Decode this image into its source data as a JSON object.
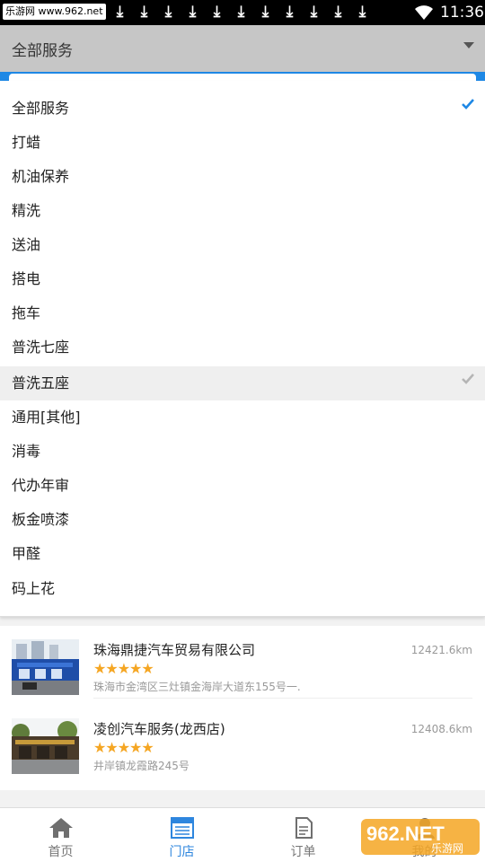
{
  "status_bar": {
    "watermark": "乐游网 www.962.net",
    "download_icons": [
      "download-icon",
      "download-icon",
      "download-icon",
      "download-icon",
      "download-icon",
      "download-icon",
      "download-icon",
      "download-icon",
      "download-icon",
      "download-icon",
      "download-icon"
    ],
    "time": "11:36"
  },
  "header": {
    "selected": "全部服务"
  },
  "dropdown": {
    "options": [
      {
        "label": "全部服务",
        "checked": true
      },
      {
        "label": "打蜡"
      },
      {
        "label": "机油保养"
      },
      {
        "label": "精洗"
      },
      {
        "label": "送油"
      },
      {
        "label": "搭电"
      },
      {
        "label": "拖车"
      },
      {
        "label": "普洗七座"
      },
      {
        "label": "普洗五座",
        "highlighted": true
      },
      {
        "label": "通用[其他]"
      },
      {
        "label": "消毒"
      },
      {
        "label": "代办年审"
      },
      {
        "label": "板金喷漆"
      },
      {
        "label": "甲醛"
      },
      {
        "label": "码上花"
      }
    ],
    "check_color": "#1e88e5"
  },
  "stores": [
    {
      "name": "珠海鼎捷汽车贸易有限公司",
      "distance": "12421.6km",
      "rating": 5,
      "stars": "★★★★★",
      "address": "珠海市金湾区三灶镇金海岸大道东155号一."
    },
    {
      "name": "凌创汽车服务(龙西店)",
      "distance": "12408.6km",
      "rating": 5,
      "stars": "★★★★★",
      "address": "井岸镇龙霞路245号"
    }
  ],
  "bottom_nav": {
    "items": [
      {
        "label": "首页",
        "icon": "home-icon"
      },
      {
        "label": "门店",
        "icon": "store-icon",
        "active": true
      },
      {
        "label": "订单",
        "icon": "order-icon"
      },
      {
        "label": "我的",
        "icon": "user-icon"
      }
    ]
  },
  "watermark_logo": {
    "text": "962.NET",
    "subtext": "乐游网"
  },
  "colors": {
    "accent": "#2e86de",
    "star": "#f5a623",
    "header_bg": "#c6c6c6",
    "band": "#1e88e5"
  }
}
